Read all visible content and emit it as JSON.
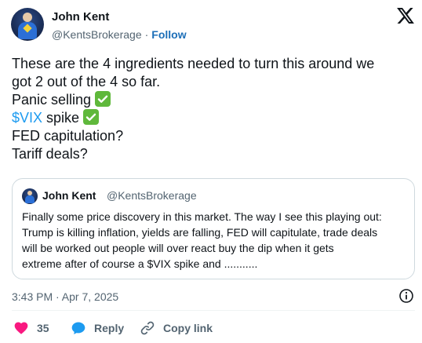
{
  "author": {
    "name": "John Kent",
    "handle": "@KentsBrokerage",
    "separator": "·",
    "follow_label": "Follow"
  },
  "tweet": {
    "line1": "These are the 4 ingredients needed to turn this around we",
    "line2": "got 2 out of the 4 so far.",
    "line3": "Panic selling",
    "line4_cashtag": "$VIX",
    "line4_rest": " spike",
    "line5": "FED capitulation?",
    "line6": "Tariff deals?"
  },
  "quote": {
    "name": "John Kent",
    "handle": "@KentsBrokerage",
    "lines": [
      "Finally some price discovery in this market. The way I see this playing out:",
      "Trump is killing inflation, yields are falling, FED will capitulate, trade deals",
      "will be worked out  people will over react buy the dip when it gets",
      "extreme after of course a $VIX spike and ..........."
    ]
  },
  "timestamp": "3:43 PM · Apr 7, 2025",
  "actions": {
    "like_count": "35",
    "reply_label": "Reply",
    "copy_label": "Copy link"
  },
  "colors": {
    "like": "#f91880",
    "reply": "#1d9bf0",
    "link": "#1d9bf0",
    "check": "#5fb83b"
  },
  "icons": [
    "x-logo-icon",
    "check-icon",
    "info-icon",
    "heart-icon",
    "reply-bubble-icon",
    "link-icon"
  ]
}
